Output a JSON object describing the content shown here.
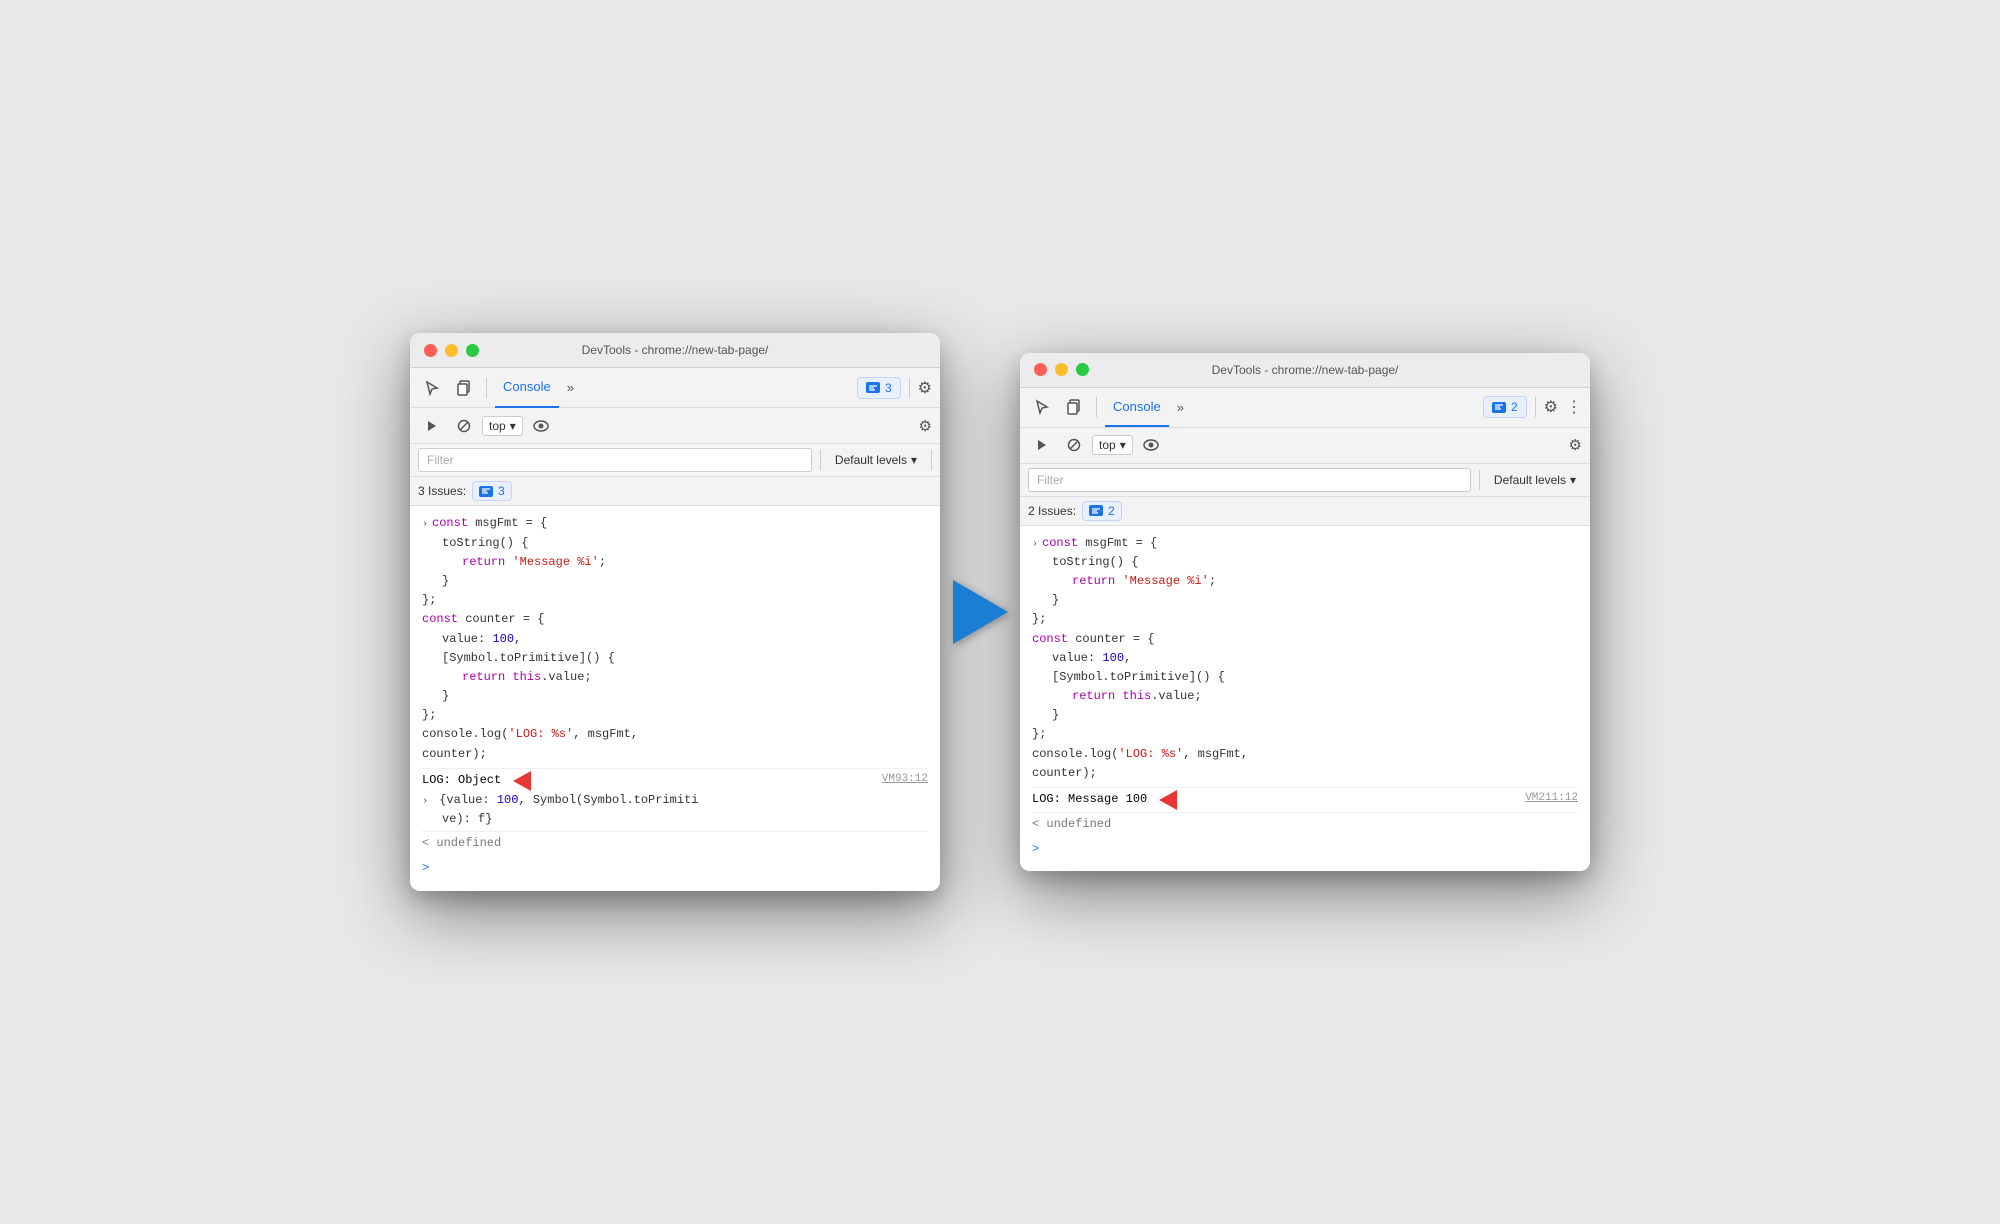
{
  "left_window": {
    "title": "DevTools - chrome://new-tab-page/",
    "tab_label": "Console",
    "issues_count": "3",
    "filter_placeholder": "Filter",
    "default_levels": "Default levels",
    "issues_label": "3 Issues:",
    "top_label": "top",
    "code": {
      "line1": "> const msgFmt = {",
      "line2": "    toString() {",
      "line3": "      return 'Message %i';",
      "line4": "    }",
      "line5": "  };",
      "line6": "  const counter = {",
      "line7": "    value: 100,",
      "line8": "    [Symbol.toPrimitive]() {",
      "line9": "      return this.value;",
      "line10": "    }",
      "line11": "  };",
      "line12": "  console.log('LOG: %s', msgFmt,",
      "line13": "  counter);"
    },
    "log_output": "LOG: Object",
    "vm_ref": "VM93:12",
    "obj_detail": "{value: 100, Symbol(Symbol.toPrimiti",
    "obj_detail2": "ve): f}",
    "undefined_text": "< undefined",
    "prompt": ">"
  },
  "right_window": {
    "title": "DevTools - chrome://new-tab-page/",
    "tab_label": "Console",
    "issues_count": "2",
    "filter_placeholder": "Filter",
    "default_levels": "Default levels",
    "issues_label": "2 Issues:",
    "top_label": "top",
    "code": {
      "line1": "> const msgFmt = {",
      "line2": "    toString() {",
      "line3": "      return 'Message %i';",
      "line4": "    }",
      "line5": "  };",
      "line6": "  const counter = {",
      "line7": "    value: 100,",
      "line8": "    [Symbol.toPrimitive]() {",
      "line9": "      return this.value;",
      "line10": "    }",
      "line11": "  };",
      "line12": "  console.log('LOG: %s', msgFmt,",
      "line13": "  counter);"
    },
    "log_output": "LOG: Message 100",
    "vm_ref": "VM211:12",
    "undefined_text": "< undefined",
    "prompt": ">"
  },
  "icons": {
    "gear": "⚙",
    "dots": "⋮",
    "chevron": "»",
    "eye": "👁",
    "block": "🚫",
    "sidebar": "▣",
    "cursor": "↖",
    "copy": "⧉",
    "play": "▶",
    "down": "▾"
  }
}
